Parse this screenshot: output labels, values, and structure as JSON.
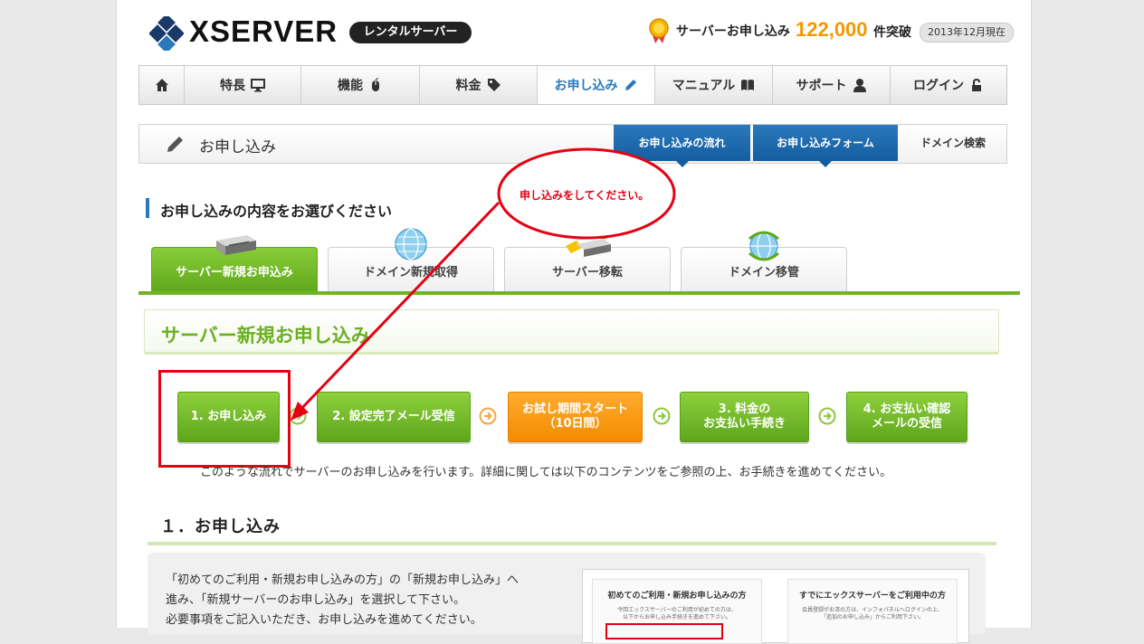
{
  "header": {
    "logo_text": "XSERVER",
    "logo_badge": "レンタルサーバー",
    "count_label": "サーバーお申し込み",
    "count_value": "122,000",
    "count_unit": "件突破",
    "count_date": "2013年12月現在",
    "medal_icon": "medal-icon"
  },
  "nav": {
    "items": [
      {
        "label": "",
        "icon": "home-icon"
      },
      {
        "label": "特長",
        "icon": "monitor-icon"
      },
      {
        "label": "機能",
        "icon": "mouse-icon"
      },
      {
        "label": "料金",
        "icon": "tag-icon"
      },
      {
        "label": "お申し込み",
        "icon": "pencil-icon",
        "active": true
      },
      {
        "label": "マニュアル",
        "icon": "book-icon"
      },
      {
        "label": "サポート",
        "icon": "person-icon"
      },
      {
        "label": "ログイン",
        "icon": "lock-icon"
      }
    ]
  },
  "titlebar": {
    "title": "お申し込み",
    "subtabs": [
      "お申し込みの流れ",
      "お申し込みフォーム",
      "ドメイン検索"
    ]
  },
  "section": {
    "heading": "お申し込みの内容をお選びください"
  },
  "tabs": [
    {
      "label": "サーバー新規お申込み",
      "active": true,
      "icon": "server-icon"
    },
    {
      "label": "ドメイン新規取得",
      "icon": "globe-icon"
    },
    {
      "label": "サーバー移転",
      "icon": "server-transfer-icon"
    },
    {
      "label": "ドメイン移管",
      "icon": "globe-transfer-icon"
    }
  ],
  "box": {
    "heading": "サーバー新規お申し込み"
  },
  "steps": [
    {
      "label": "1. お申し込み",
      "color": "green"
    },
    {
      "label": "2. 設定完了メール受信",
      "color": "green"
    },
    {
      "label": "お試し期間スタート\n（10日間）",
      "color": "orange"
    },
    {
      "label": "3. 料金の\nお支払い手続き",
      "color": "green"
    },
    {
      "label": "4. お支払い確認\nメールの受信",
      "color": "green"
    }
  ],
  "flow_description": "このような流れでサーバーのお申し込みを行います。詳細に関しては以下のコンテンツをご参照の上、お手続きを進めてください。",
  "section1": {
    "title": "１．お申し込み",
    "lines": [
      "「初めてのご利用・新規お申し込みの方」の「新規お申し込み」へ",
      "進み、「新規サーバーのお申し込み」を選択して下さい。",
      "必要事項をご記入いただき、お申し込みを進めてください。"
    ],
    "thumb": {
      "left_title": "初めてのご利用・新規お申し込みの方",
      "left_text": "今回エックスサーバーのご利用が初めての方は、\n以下からお申し込み手続きを進めて下さい。",
      "right_title": "すでにエックスサーバーをご利用中の方",
      "right_text": "会員登録がお済の方は、インフォパネルへログインの上、\n「追加のお申し込み」からご利用下さい。"
    }
  },
  "annotation": {
    "callout_text": "申し込みをしてください。",
    "color": "#e60012"
  },
  "colors": {
    "green": "#6cb021",
    "blue": "#2a79b8",
    "orange": "#f39800",
    "red": "#e60012"
  }
}
